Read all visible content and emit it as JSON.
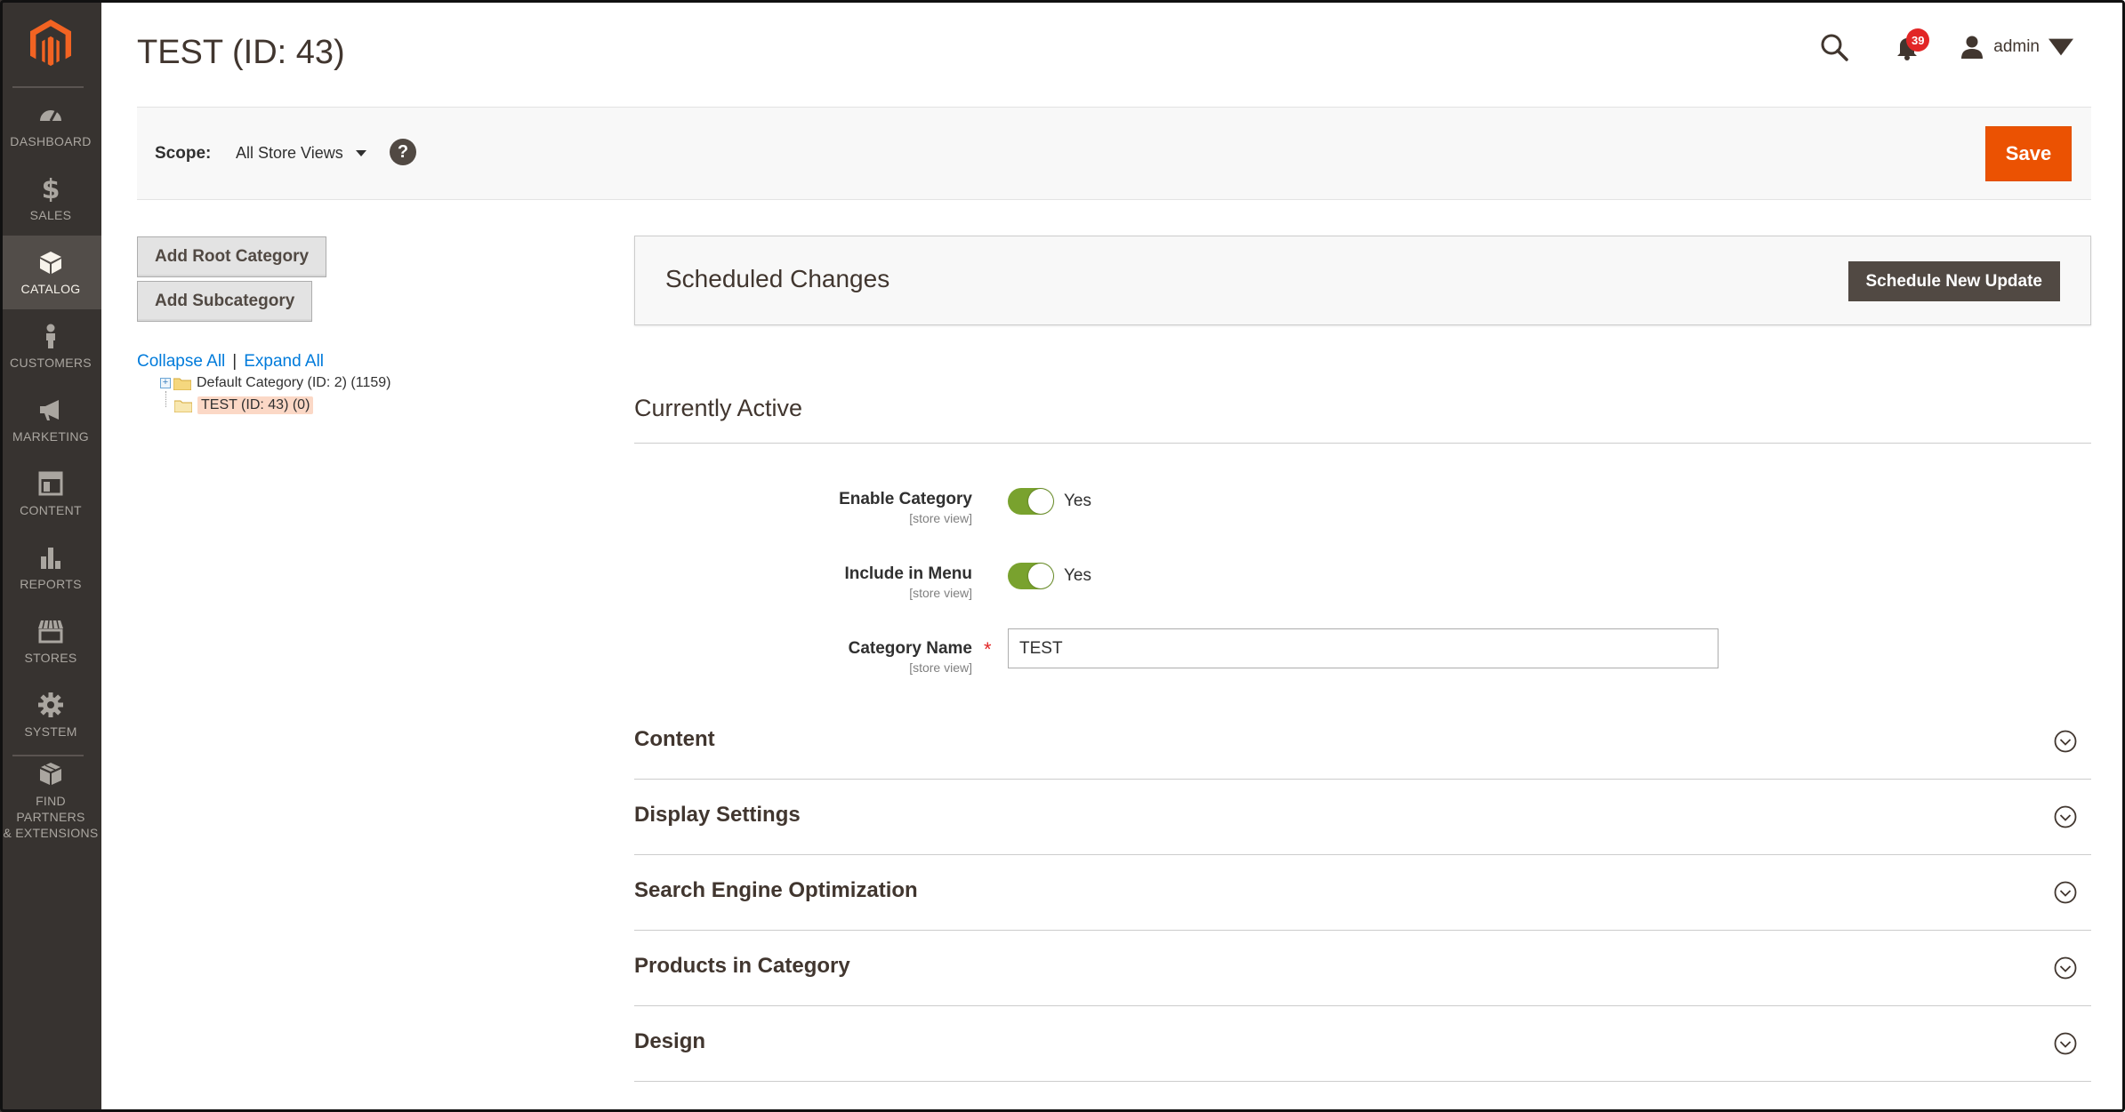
{
  "sidebar": {
    "items": [
      {
        "label": "DASHBOARD",
        "icon": "dashboard-icon"
      },
      {
        "label": "SALES",
        "icon": "dollar-icon"
      },
      {
        "label": "CATALOG",
        "icon": "box-icon"
      },
      {
        "label": "CUSTOMERS",
        "icon": "person-icon"
      },
      {
        "label": "MARKETING",
        "icon": "megaphone-icon"
      },
      {
        "label": "CONTENT",
        "icon": "layout-icon"
      },
      {
        "label": "REPORTS",
        "icon": "bar-chart-icon"
      },
      {
        "label": "STORES",
        "icon": "storefront-icon"
      },
      {
        "label": "SYSTEM",
        "icon": "gear-icon"
      },
      {
        "label": "FIND PARTNERS\n& EXTENSIONS",
        "label_line1": "FIND PARTNERS",
        "label_line2": "& EXTENSIONS",
        "icon": "cubes-icon"
      }
    ],
    "active": "CATALOG"
  },
  "header": {
    "title": "TEST (ID: 43)",
    "notifications_count": "39",
    "user": "admin"
  },
  "scope": {
    "label": "Scope:",
    "value": "All Store Views",
    "help": "?",
    "save_label": "Save"
  },
  "tree": {
    "add_root": "Add Root Category",
    "add_sub": "Add Subcategory",
    "collapse_all": "Collapse All",
    "separator": "|",
    "expand_all": "Expand All",
    "nodes": [
      {
        "label": "Default Category (ID: 2) (1159)"
      },
      {
        "label": "TEST (ID: 43) (0)",
        "selected": true
      }
    ]
  },
  "scheduled": {
    "title": "Scheduled Changes",
    "button": "Schedule New Update"
  },
  "active_section": {
    "title": "Currently Active",
    "fields": [
      {
        "label": "Enable Category",
        "scope": "[store view]",
        "value": "Yes"
      },
      {
        "label": "Include in Menu",
        "scope": "[store view]",
        "value": "Yes"
      },
      {
        "label": "Category Name",
        "scope": "[store view]",
        "value": "TEST",
        "required": "*"
      }
    ]
  },
  "sections": [
    {
      "title": "Content"
    },
    {
      "title": "Display Settings"
    },
    {
      "title": "Search Engine Optimization"
    },
    {
      "title": "Products in Category"
    },
    {
      "title": "Design"
    }
  ],
  "colors": {
    "sidebar": "#373330",
    "accent": "#eb5202",
    "toggle_on": "#79a22e",
    "link": "#007bdb"
  }
}
